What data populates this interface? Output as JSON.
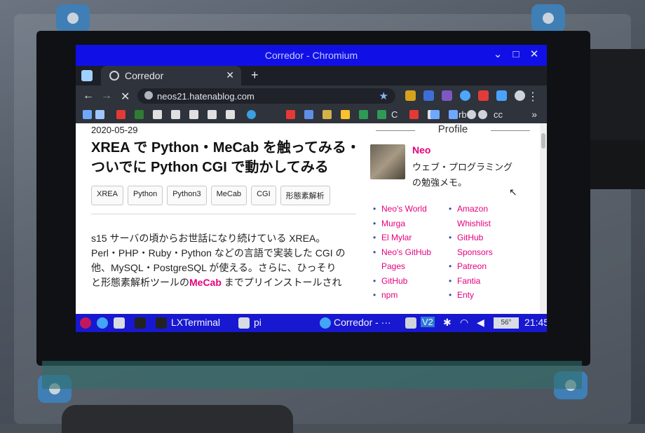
{
  "window": {
    "title": "Corredor - Chromium"
  },
  "tab": {
    "title": "Corredor"
  },
  "omnibox": {
    "url": "neos21.hatenablog.com"
  },
  "bookmarks": {
    "text_items": [
      "C",
      "rb",
      "cc"
    ]
  },
  "article": {
    "date": "2020-05-29",
    "title": "XREA で Python・MeCab を触ってみる・ついでに Python CGI で動かしてみる",
    "tags": [
      "XREA",
      "Python",
      "Python3",
      "MeCab",
      "CGI",
      "形態素解析"
    ],
    "body_lines": [
      "s15 サーバの頃からお世話になり続けている XREA。",
      "Perl・PHP・Ruby・Python などの言語で実装した CGI の",
      "他、MySQL・PostgreSQL が使える。さらに、ひっそり",
      "と形態素解析ツールの"
    ],
    "body_highlight": "MeCab",
    "body_tail": " までプリインストールされ"
  },
  "sidebar": {
    "title": "Profile",
    "name": "Neo",
    "desc": "ウェブ・プログラミングの勉強メモ。",
    "links_left": [
      "Neo's World",
      "Murga",
      "El Mylar",
      "Neo's GitHub",
      "Pages",
      "GitHub",
      "npm"
    ],
    "links_right": [
      "Amazon",
      "Whishlist",
      "GitHub",
      "Sponsors",
      "Patreon",
      "Fantia",
      "Enty"
    ]
  },
  "taskbar": {
    "lxterminal": "LXTerminal",
    "folder": "pi",
    "browser": "Corredor - ···",
    "vnc": "V2",
    "temp": "56°",
    "clock": "21:45"
  },
  "colors": {
    "titlebar": "#1010e6",
    "accent_link": "#e6007e",
    "taskbar": "#1818d0"
  }
}
